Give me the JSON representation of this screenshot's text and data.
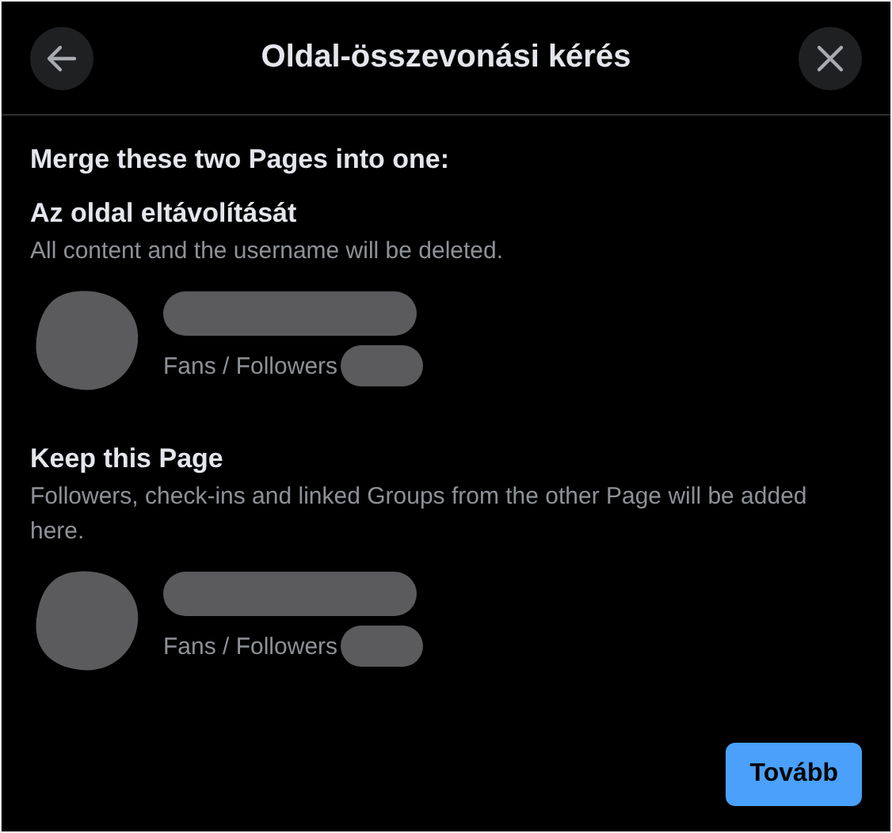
{
  "dialog": {
    "title": "Oldal-összevonási kérés",
    "intro": "Merge these two Pages into one:"
  },
  "sections": [
    {
      "heading": "Az oldal eltávolítását",
      "description": "All content and the username will be deleted.",
      "page": {
        "subtitle": "Fans / Followers"
      }
    },
    {
      "heading": "Keep this Page",
      "description": "Followers, check-ins and linked Groups from the other Page will be added here.",
      "page": {
        "subtitle": "Fans / Followers"
      }
    }
  ],
  "buttons": {
    "next": "Tovább"
  }
}
